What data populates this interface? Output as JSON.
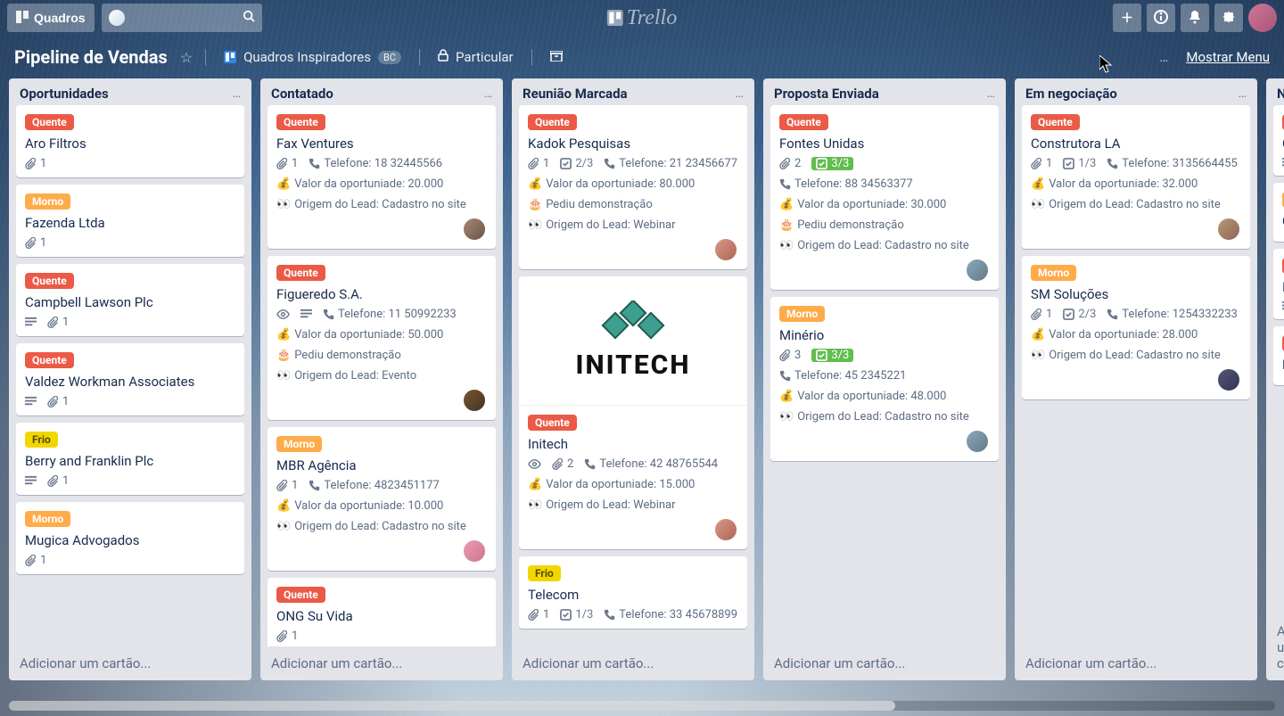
{
  "header": {
    "boards_button": "Quadros",
    "app_name": "Trello"
  },
  "board_bar": {
    "title": "Pipeline de Vendas",
    "team_label": "Quadros Inspiradores",
    "team_badge": "BC",
    "privacy": "Particular",
    "menu_label": "Mostrar Menu"
  },
  "labels": {
    "quente": "Quente",
    "morno": "Morno",
    "frio": "Frio"
  },
  "ui": {
    "add_card": "Adicionar um cartão..."
  },
  "lists": [
    {
      "title": "Oportunidades",
      "cards": [
        {
          "label": "quente",
          "title": "Aro Filtros",
          "badges": {
            "attachments": 1
          }
        },
        {
          "label": "morno",
          "title": "Fazenda Ltda",
          "badges": {
            "attachments": 1
          }
        },
        {
          "label": "quente",
          "title": "Campbell Lawson Plc",
          "badges": {
            "description": true,
            "attachments": 1
          }
        },
        {
          "label": "quente",
          "title": "Valdez Workman Associates",
          "badges": {
            "description": true,
            "attachments": 1
          }
        },
        {
          "label": "frio",
          "title": "Berry and Franklin Plc",
          "badges": {
            "description": true,
            "attachments": 1
          }
        },
        {
          "label": "morno",
          "title": "Mugica Advogados",
          "badges": {
            "attachments": 1
          }
        }
      ]
    },
    {
      "title": "Contatado",
      "cards": [
        {
          "label": "quente",
          "title": "Fax Ventures",
          "badges": {
            "attachments": 1,
            "phone": "Telefone: 18 32445566",
            "value": "Valor da oportuniade: 20.000",
            "origin": "Origem do Lead: Cadastro no site"
          },
          "member": "m1"
        },
        {
          "label": "quente",
          "title": "Figueredo S.A.",
          "badges": {
            "watch": true,
            "description": true,
            "phone": "Telefone: 11 50992233",
            "value": "Valor da oportuniade: 50.000",
            "demo": "Pediu demonstração",
            "origin": "Origem do Lead: Evento"
          },
          "member": "m3"
        },
        {
          "label": "morno",
          "title": "MBR Agência",
          "badges": {
            "attachments": 1,
            "phone": "Telefone: 4823451177",
            "value": "Valor da oportuniade: 10.000",
            "origin": "Origem do Lead: Cadastro no site"
          },
          "member": "m4"
        },
        {
          "label": "quente",
          "title": "ONG Su Vida",
          "badges": {
            "attachments": 1
          },
          "member": "m6"
        }
      ]
    },
    {
      "title": "Reunião Marcada",
      "cards": [
        {
          "label": "quente",
          "title": "Kadok Pesquisas",
          "badges": {
            "attachments": 1,
            "checklist": "2/3",
            "phone": "Telefone: 21 23456677",
            "value": "Valor da oportuniade: 80.000",
            "demo": "Pediu demonstração",
            "origin": "Origem do Lead: Webinar"
          },
          "member": "m2"
        },
        {
          "cover": "initech",
          "label": "quente",
          "title": "Initech",
          "badges": {
            "watch": true,
            "attachments": 2,
            "phone": "Telefone: 42 48765544",
            "value": "Valor da oportuniade: 15.000",
            "origin": "Origem do Lead: Webinar"
          },
          "member": "m2"
        },
        {
          "label": "frio",
          "title": "Telecom",
          "badges": {
            "attachments": 1,
            "checklist": "1/3",
            "phone": "Telefone: 33 45678899"
          }
        }
      ]
    },
    {
      "title": "Proposta Enviada",
      "cards": [
        {
          "label": "quente",
          "title": "Fontes Unidas",
          "badges": {
            "attachments": 2,
            "checklist": "3/3",
            "checklist_done": true,
            "phone": "Telefone: 88 34563377",
            "value": "Valor da oportuniade: 30.000",
            "demo": "Pediu demonstração",
            "origin": "Origem do Lead: Cadastro no site"
          },
          "member": "m5"
        },
        {
          "label": "morno",
          "title": "Minério",
          "badges": {
            "attachments": 3,
            "checklist": "3/3",
            "checklist_done": true,
            "phone": "Telefone: 45 2345221",
            "value": "Valor da oportuniade: 48.000",
            "origin": "Origem do Lead: Cadastro no site"
          },
          "member": "m5"
        }
      ]
    },
    {
      "title": "Em negociação",
      "cards": [
        {
          "label": "quente",
          "title": "Construtora LA",
          "badges": {
            "attachments": 1,
            "checklist": "1/3",
            "phone": "Telefone: 3135664455",
            "value": "Valor da oportuniade: 32.000",
            "origin": "Origem do Lead: Cadastro no site"
          },
          "member": "m6"
        },
        {
          "label": "morno",
          "title": "SM Soluções",
          "badges": {
            "attachments": 1,
            "checklist": "2/3",
            "phone": "Telefone: 1254332233",
            "value": "Valor da oportuniade: 28.000",
            "origin": "Origem do Lead: Cadastro no site"
          },
          "member": "m7"
        }
      ]
    },
    {
      "title": "Ne",
      "partial": true,
      "cards": [
        {
          "label": "quente",
          "title": "Ca",
          "badges": {
            "description": true
          }
        },
        {
          "label": "morno",
          "title": "Co",
          "badges": {}
        },
        {
          "label": "quente",
          "title": "Int",
          "badges": {
            "description": true
          }
        },
        {
          "label": "quente",
          "title": "Lo",
          "badges": {}
        }
      ]
    }
  ]
}
